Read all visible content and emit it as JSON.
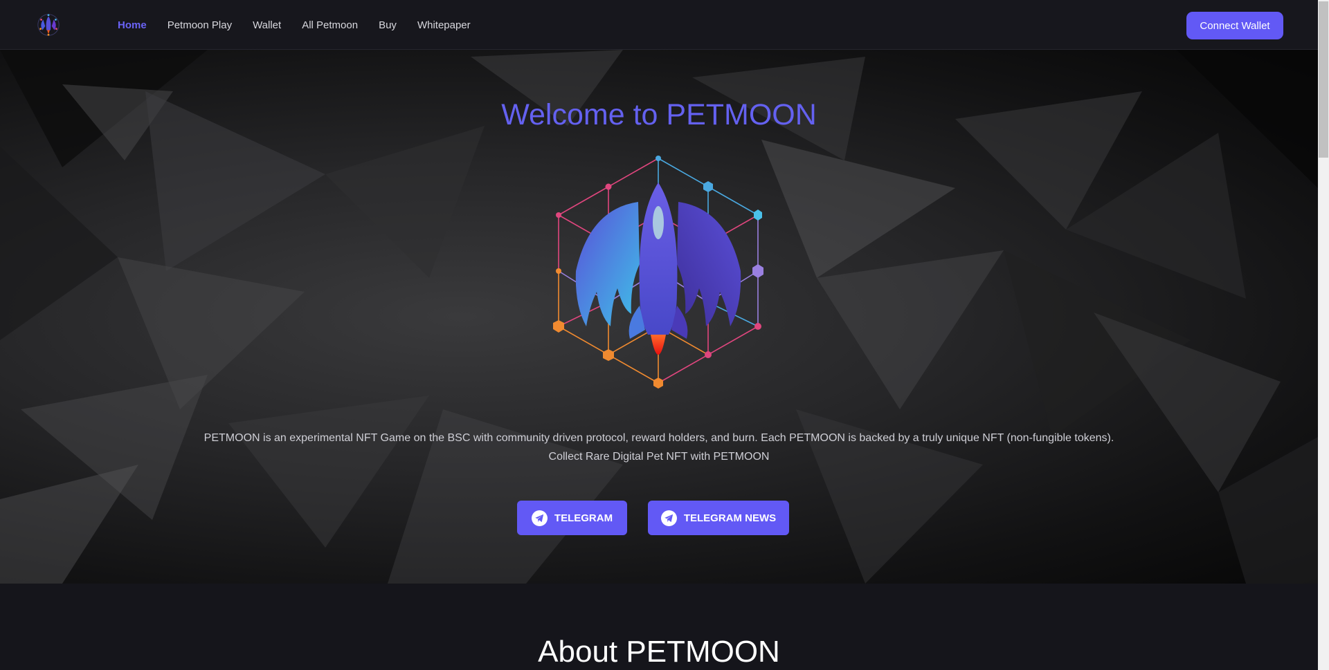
{
  "nav": {
    "logo_icon": "rocket-logo-icon",
    "links": [
      {
        "label": "Home",
        "active": true
      },
      {
        "label": "Petmoon Play"
      },
      {
        "label": "Wallet"
      },
      {
        "label": "All Petmoon"
      },
      {
        "label": "Buy"
      },
      {
        "label": "Whitepaper"
      }
    ],
    "connect_label": "Connect Wallet"
  },
  "hero": {
    "title": "Welcome to PETMOON",
    "art_icon": "winged-rocket-hexagon-icon",
    "description_line1": "PETMOON is an experimental NFT Game on the BSC with community driven protocol, reward holders, and burn. Each PETMOON is backed by a truly unique NFT (non-fungible tokens).",
    "description_line2": "Collect Rare Digital Pet NFT with PETMOON",
    "buttons": [
      {
        "label": "TELEGRAM",
        "icon": "telegram-icon"
      },
      {
        "label": "TELEGRAM NEWS",
        "icon": "telegram-icon"
      }
    ]
  },
  "about": {
    "title": "About PETMOON"
  },
  "colors": {
    "accent": "#6259f5",
    "title": "#6461f0",
    "background": "#15151b"
  }
}
